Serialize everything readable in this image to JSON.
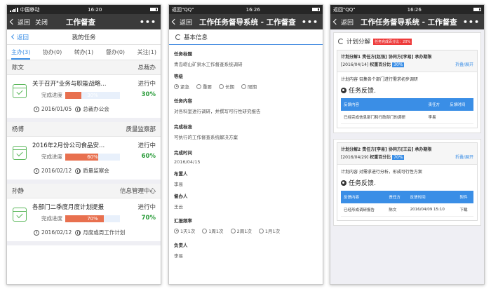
{
  "screen1": {
    "status": {
      "carrier": "中国移动",
      "time": "16:20"
    },
    "nav": {
      "back": "返回",
      "close": "关闭",
      "title": "工作督查"
    },
    "sub": {
      "back": "返回",
      "title": "我的任务"
    },
    "tabs": [
      {
        "label": "主办(3)",
        "active": true
      },
      {
        "label": "协办(0)",
        "active": false
      },
      {
        "label": "转办(1)",
        "active": false
      },
      {
        "label": "督办(0)",
        "active": false
      },
      {
        "label": "关注(1)",
        "active": false
      }
    ],
    "tasks": [
      {
        "person": "陈文",
        "dept": "总裁办",
        "title": "关于召开\"业务与职能战略...",
        "status": "进行中",
        "progress_label": "完成进度",
        "progress_text": "30%",
        "progress": 30,
        "pct": "30%",
        "date": "2016/01/05",
        "org": "总裁办公会"
      },
      {
        "person": "杨博",
        "dept": "质量监察部",
        "title": "2016年2月份公司食品安...",
        "status": "进行中",
        "progress_label": "完成进度",
        "progress_text": "60%",
        "progress": 60,
        "pct": "60%",
        "date": "2016/02/12",
        "org": "质量监察会"
      },
      {
        "person": "孙静",
        "dept": "信息管理中心",
        "title": "各部门二季度月度计划提报",
        "status": "进行中",
        "progress_label": "完成进度",
        "progress_text": "70%",
        "progress": 70,
        "pct": "70%",
        "date": "2016/02/12",
        "org": "月度或周工作计划"
      }
    ]
  },
  "screen2": {
    "status": {
      "carrier": "返回\"QQ\"",
      "time": "16:26"
    },
    "nav": {
      "back": "返回",
      "title": "工作任务督导系统 - 工作督查"
    },
    "section": "基本信息",
    "fields": [
      {
        "label": "任务标题",
        "value": "青岛崂山矿泉水工作督查系统调研"
      },
      {
        "label": "等级",
        "radios": [
          {
            "text": "紧急",
            "on": true
          },
          {
            "text": "重要",
            "on": false
          },
          {
            "text": "长期",
            "on": false
          },
          {
            "text": "限期",
            "on": false
          }
        ]
      },
      {
        "label": "任务内容",
        "value": "对各科室进行调研，并撰写可行性研究报告"
      },
      {
        "label": "完成标准",
        "value": "可执行的工作督查系统解决方案"
      },
      {
        "label": "完成时间",
        "value": "2016/04/15"
      },
      {
        "label": "布置人",
        "value": "李易"
      },
      {
        "label": "督办人",
        "value": "王云"
      },
      {
        "label": "汇报频率",
        "radios": [
          {
            "text": "1天1次",
            "on": true
          },
          {
            "text": "1周1次",
            "on": false
          },
          {
            "text": "2周1次",
            "on": false
          },
          {
            "text": "1月1次",
            "on": false
          }
        ]
      },
      {
        "label": "负责人",
        "value": "李易"
      }
    ]
  },
  "screen3": {
    "status": {
      "carrier": "返回\"QQ\"",
      "time": "16:26"
    },
    "nav": {
      "back": "返回",
      "title": "工作任务督导系统 - 工作督查"
    },
    "section": "计划分解",
    "section_badge": "任务完成百分比：20%",
    "plans": [
      {
        "line1": "计划分解1  责任方[赵强]  协同方[李易]  承办期限",
        "date": "[2016/04/14]",
        "weight_label": "权重百分比",
        "weight": "30%",
        "toggle": "折叠/展开",
        "content": "计划内容 召集各个部门进行需求初步调研",
        "feedback": "任务反馈.",
        "headers": [
          "反馈内容",
          "责任方",
          "反馈时间"
        ],
        "rows": [
          [
            "已经完成信息部门和行政部门的调研",
            "李易",
            ""
          ]
        ]
      },
      {
        "line1": "计划分解2  责任方[李易]  协同方[王云]  承办期限",
        "date": "[2016/04/29]",
        "weight_label": "权重百分比",
        "weight": "70%",
        "toggle": "折叠/展开",
        "content": "计划内容 对需求进行分析，形成可行性方案",
        "feedback": "任务反馈.",
        "headers": [
          "反馈内容",
          "责任方",
          "反馈时间",
          "附件"
        ],
        "rows": [
          [
            "已经形成调研报告",
            "陈文",
            "2016/04/09 15:10",
            "下载"
          ]
        ]
      }
    ]
  },
  "colors": {
    "accent": "#3a8ee6",
    "progress": "#e8704f",
    "done": "#2a9c3a",
    "navbar": "#3b3b3b"
  }
}
